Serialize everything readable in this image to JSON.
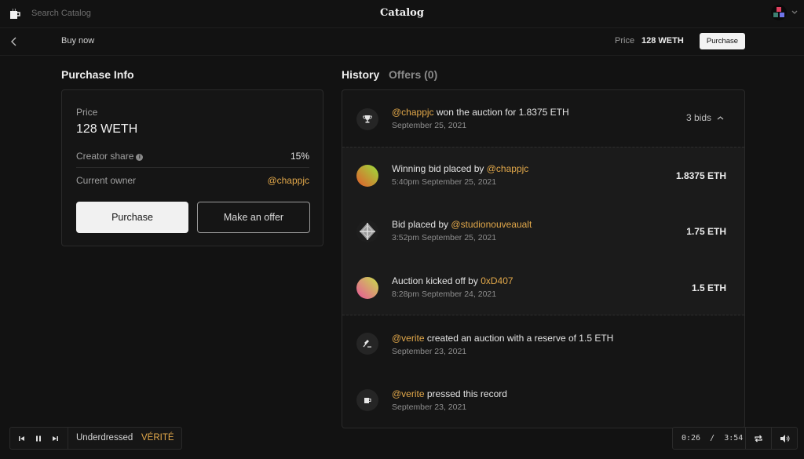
{
  "topbar": {
    "search_placeholder": "Search Catalog",
    "brand": "Catalog",
    "logo_icon": "coffee-cup-icon",
    "avatar_icon": "profile-avatar-icon",
    "menu_icon": "chevron-down-icon"
  },
  "subbar": {
    "back_icon": "chevron-left-icon",
    "title": "Buy now",
    "price_label": "Price",
    "price_value": "128 WETH",
    "purchase_label": "Purchase"
  },
  "purchase_info": {
    "title": "Purchase Info",
    "price_label": "Price",
    "price_value": "128 WETH",
    "creator_share_label": "Creator share",
    "creator_share_value": "15%",
    "info_icon": "info-icon",
    "owner_label": "Current owner",
    "owner_value": "@chappjc",
    "purchase_button": "Purchase",
    "offer_button": "Make an offer"
  },
  "tabs": [
    {
      "label": "History",
      "active": true
    },
    {
      "label": "Offers (0)",
      "active": false
    }
  ],
  "history": {
    "auction_won": {
      "icon": "trophy-icon",
      "user": "@chappjc",
      "text": " won the auction for 1.8375 ETH",
      "date": "September 25, 2021",
      "bids_toggle": "3 bids",
      "toggle_icon": "chevron-up-icon"
    },
    "bids": [
      {
        "prefix": "Winning bid placed by ",
        "user": "@chappjc",
        "time": "5:40pm September 25, 2021",
        "amount": "1.8375 ETH",
        "avatar": "gradient-avatar-orange-green"
      },
      {
        "prefix": "Bid placed by ",
        "user": "@studionouveaualt",
        "time": "3:52pm September 25, 2021",
        "amount": "1.75 ETH",
        "avatar": "silver-crystal-avatar"
      },
      {
        "prefix": "Auction kicked off by ",
        "user": "0xD407",
        "time": "8:28pm September 24, 2021",
        "amount": "1.5 ETH",
        "avatar": "gradient-avatar-pink-yellow"
      }
    ],
    "events": [
      {
        "icon": "gavel-icon",
        "user": "@verite",
        "text": " created an auction with a reserve of 1.5 ETH",
        "date": "September 23, 2021"
      },
      {
        "icon": "coffee-cup-icon",
        "user": "@verite",
        "text": " pressed this record",
        "date": "September 23, 2021"
      }
    ]
  },
  "player": {
    "track": "Underdressed",
    "artist": "VÉRITÉ",
    "elapsed": "0:26",
    "separator": "/",
    "duration": "3:54",
    "prev_icon": "skip-back-icon",
    "pause_icon": "pause-icon",
    "next_icon": "skip-forward-icon",
    "repeat_icon": "repeat-icon",
    "volume_icon": "volume-icon"
  },
  "colors": {
    "accent_gold": "#e2a84a",
    "background": "#121212",
    "panel": "#151515"
  }
}
